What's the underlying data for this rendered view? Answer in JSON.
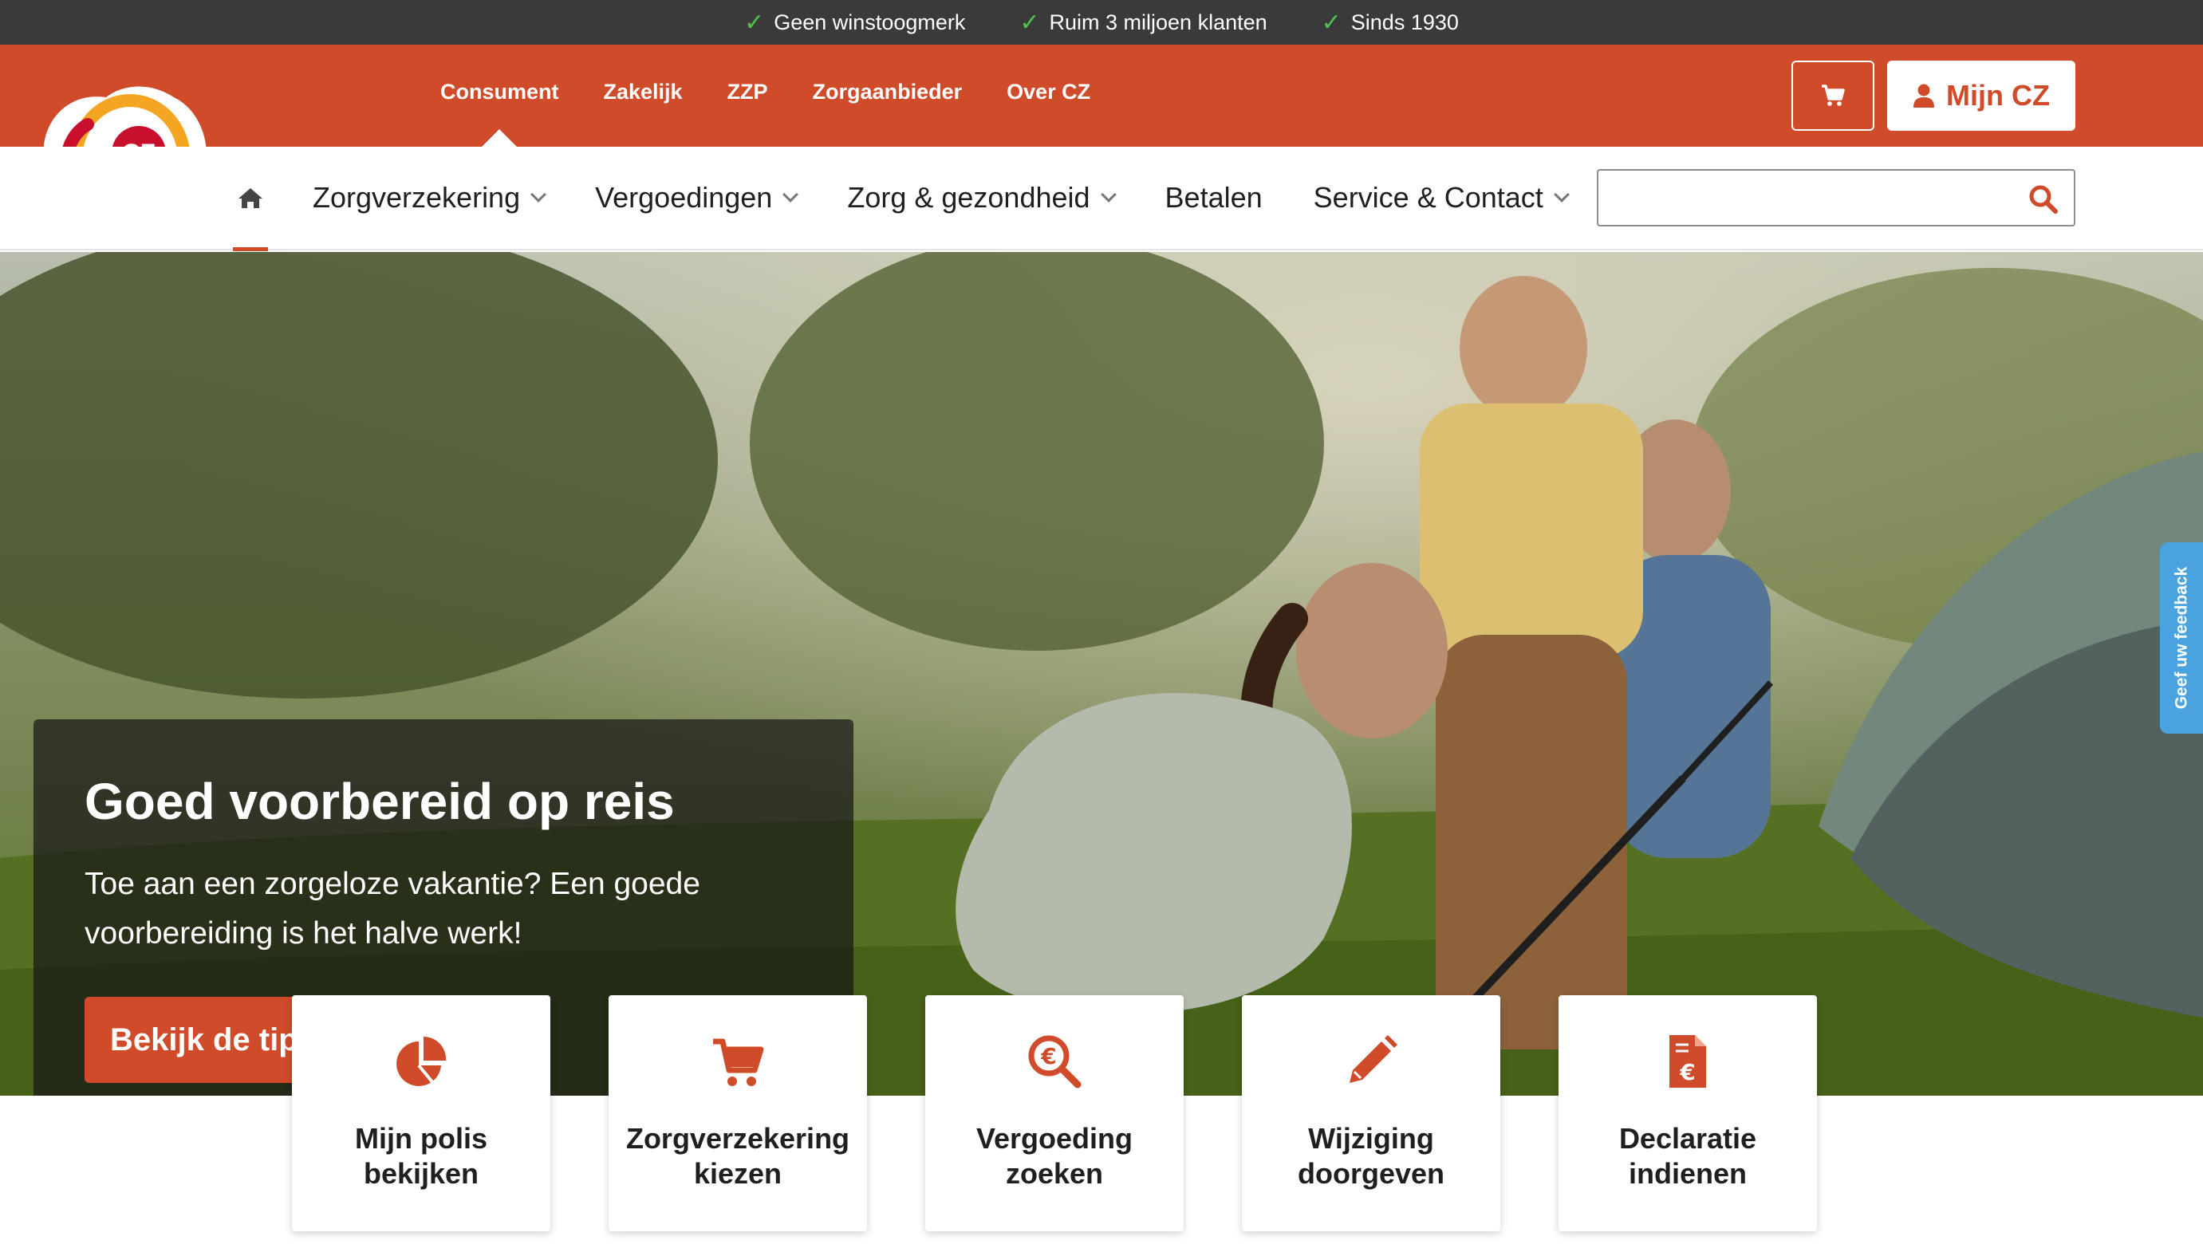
{
  "usp_bar": {
    "items": [
      {
        "icon": "check-icon",
        "label": "Geen winstoogmerk"
      },
      {
        "icon": "check-icon",
        "label": "Ruim 3 miljoen klanten"
      },
      {
        "icon": "check-icon",
        "label": "Sinds 1930"
      }
    ]
  },
  "brand": {
    "logo_text": "CZ",
    "accent": "#cf4b2a",
    "dark": "#3a3a3a"
  },
  "segments": [
    "Consument",
    "Zakelijk",
    "ZZP",
    "Zorgaanbieder",
    "Over CZ"
  ],
  "segments_active": "Consument",
  "header_actions": {
    "cart_icon": "cart-icon",
    "account_icon": "user-icon",
    "account_label": "Mijn CZ"
  },
  "main_nav": {
    "home_icon": "home-icon",
    "items": [
      {
        "label": "Zorgverzekering",
        "dropdown": true
      },
      {
        "label": "Vergoedingen",
        "dropdown": true
      },
      {
        "label": "Zorg & gezondheid",
        "dropdown": true
      },
      {
        "label": "Betalen",
        "dropdown": false
      },
      {
        "label": "Service & Contact",
        "dropdown": true
      }
    ]
  },
  "search": {
    "value": "",
    "placeholder": "",
    "icon": "search-icon"
  },
  "hero": {
    "title": "Goed voorbereid op reis",
    "text": "Toe aan een zorgeloze vakantie? Een goede voorbereiding is het halve werk!",
    "button": "Bekijk de tips"
  },
  "feedback_tab": "Geef uw feedback",
  "tiles": [
    {
      "label": "Mijn polis\nbekijken",
      "icon": "pie-chart-icon"
    },
    {
      "label": "Zorgverzekering\nkiezen",
      "icon": "cart-icon"
    },
    {
      "label": "Vergoeding\nzoeken",
      "icon": "euro-search-icon"
    },
    {
      "label": "Wijziging\ndoorgeven",
      "icon": "pencil-icon"
    },
    {
      "label": "Declaratie\nindienen",
      "icon": "euro-document-icon"
    }
  ]
}
